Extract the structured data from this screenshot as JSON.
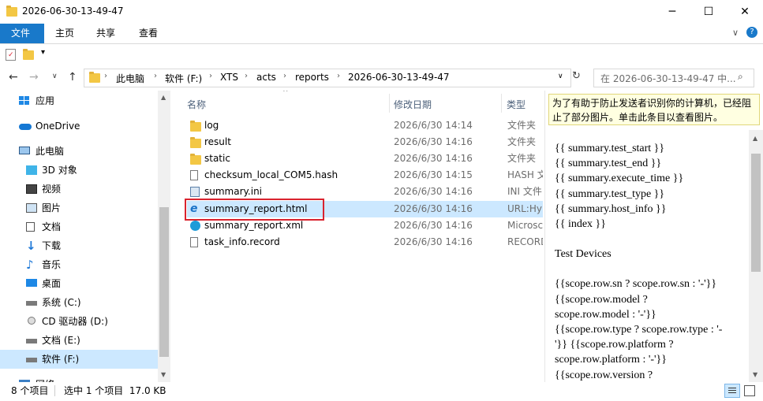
{
  "window": {
    "title": "2026-06-30-13-49-47",
    "controls": {
      "minimize": "─",
      "maximize": "☐",
      "close": "✕"
    }
  },
  "ribbon": {
    "tabs": [
      "文件",
      "主页",
      "共享",
      "查看"
    ],
    "collapse_icon": "chevron-down-icon",
    "help_icon": "?"
  },
  "address": {
    "crumbs": [
      "此电脑",
      "软件 (F:)",
      "XTS",
      "acts",
      "reports",
      "2026-06-30-13-49-47"
    ],
    "search_placeholder": "在 2026-06-30-13-49-47 中..."
  },
  "nav": {
    "items": [
      {
        "label": "应用",
        "icon": "apps-icon",
        "level": "top"
      },
      {
        "label": "OneDrive",
        "icon": "cloud-icon",
        "level": "top"
      },
      {
        "label": "此电脑",
        "icon": "pc-icon",
        "level": "top"
      },
      {
        "label": "3D 对象",
        "icon": "cube-icon",
        "level": "sub"
      },
      {
        "label": "视频",
        "icon": "video-icon",
        "level": "sub"
      },
      {
        "label": "图片",
        "icon": "picture-icon",
        "level": "sub"
      },
      {
        "label": "文档",
        "icon": "document-icon",
        "level": "sub"
      },
      {
        "label": "下载",
        "icon": "download-icon",
        "level": "sub"
      },
      {
        "label": "音乐",
        "icon": "music-icon",
        "level": "sub"
      },
      {
        "label": "桌面",
        "icon": "desktop-icon",
        "level": "sub"
      },
      {
        "label": "系统 (C:)",
        "icon": "drive-icon",
        "level": "sub"
      },
      {
        "label": "CD 驱动器 (D:)",
        "icon": "cd-icon",
        "level": "sub"
      },
      {
        "label": "文档 (E:)",
        "icon": "drive-icon",
        "level": "sub"
      },
      {
        "label": "软件 (F:)",
        "icon": "drive-icon",
        "level": "sub",
        "selected": true
      },
      {
        "label": "网络",
        "icon": "network-icon",
        "level": "top"
      }
    ]
  },
  "filelist": {
    "columns": {
      "name": "名称",
      "date": "修改日期",
      "type": "类型"
    },
    "files": [
      {
        "name": "log",
        "date": "2026/6/30 14:14",
        "type": "文件夹",
        "icon": "folder-icon"
      },
      {
        "name": "result",
        "date": "2026/6/30 14:16",
        "type": "文件夹",
        "icon": "folder-icon"
      },
      {
        "name": "static",
        "date": "2026/6/30 14:16",
        "type": "文件夹",
        "icon": "folder-icon"
      },
      {
        "name": "checksum_local_COM5.hash",
        "date": "2026/6/30 14:15",
        "type": "HASH 文",
        "icon": "file-icon"
      },
      {
        "name": "summary.ini",
        "date": "2026/6/30 14:16",
        "type": "INI 文件",
        "icon": "ini-icon"
      },
      {
        "name": "summary_report.html",
        "date": "2026/6/30 14:16",
        "type": "URL:Hyp",
        "icon": "ie-icon",
        "selected": true
      },
      {
        "name": "summary_report.xml",
        "date": "2026/6/30 14:16",
        "type": "Microsc",
        "icon": "edge-icon"
      },
      {
        "name": "task_info.record",
        "date": "2026/6/30 14:16",
        "type": "RECORD",
        "icon": "file-icon"
      }
    ]
  },
  "preview": {
    "infobar": "为了有助于防止发送者识别你的计算机，已经阻止了部分图片。单击此条目以查看图片。",
    "lines": [
      "{{ summary.test_start }}",
      "{{ summary.test_end }}",
      "{{ summary.execute_time }}",
      "{{ summary.test_type }}",
      "{{ summary.host_info }}",
      "{{ index }}",
      "",
      "Test Devices",
      "",
      "{{scope.row.sn ? scope.row.sn : '-'}}",
      "{{scope.row.model ?",
      "scope.row.model : '-'}}",
      "{{scope.row.type ? scope.row.type : '-",
      "'}} {{scope.row.platform ?",
      "scope.row.platform : '-'}}",
      "{{scope.row.version ?"
    ]
  },
  "status": {
    "count": "8 个项目",
    "selection": "选中 1 个项目  17.0 KB"
  },
  "colors": {
    "accent": "#1979ca",
    "selection": "#cce8ff",
    "highlight_box": "#d9232e"
  }
}
